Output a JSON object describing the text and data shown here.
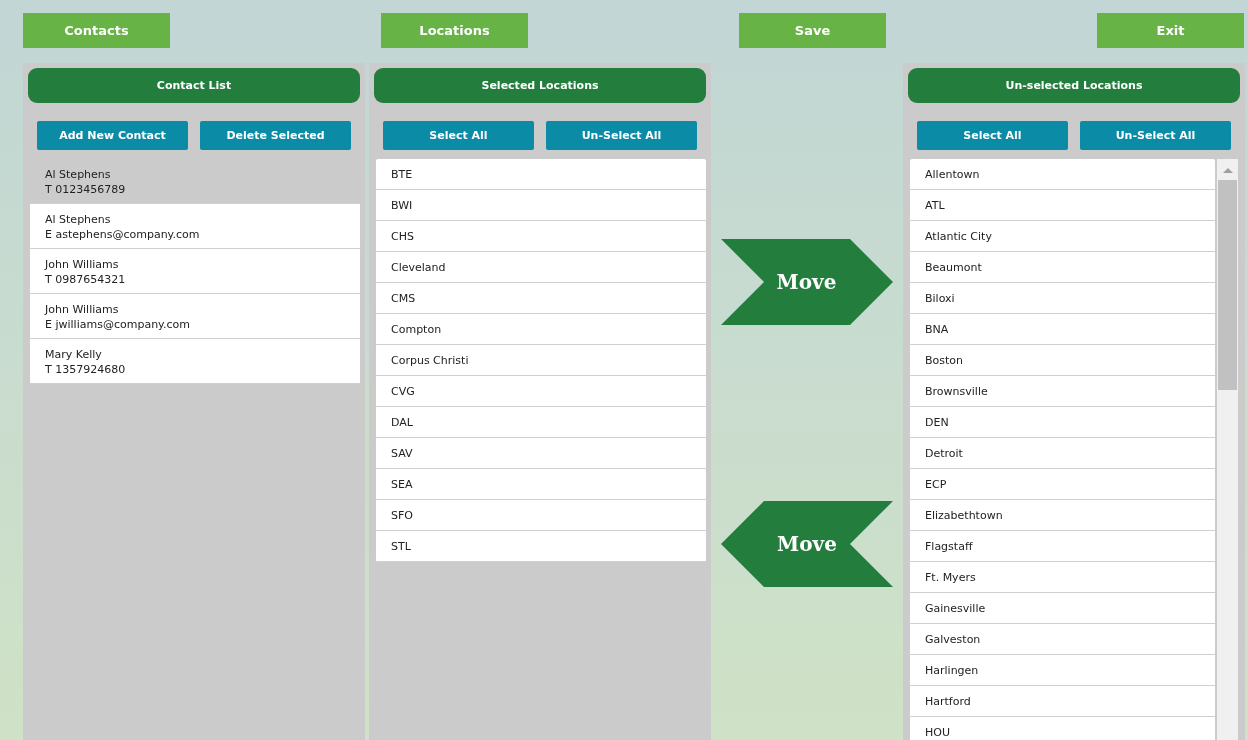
{
  "nav_buttons": [
    "Contacts",
    "Locations",
    "Save",
    "Exit"
  ],
  "contacts_panel": {
    "title": "Contact List",
    "buttons": [
      "Add New Contact",
      "Delete Selected"
    ],
    "items": [
      {
        "name": "Al Stephens",
        "detail": "T 0123456789",
        "selected": true
      },
      {
        "name": "Al Stephens",
        "detail": "E astephens@company.com",
        "selected": false
      },
      {
        "name": "John Williams",
        "detail": "T 0987654321",
        "selected": false
      },
      {
        "name": "John Williams",
        "detail": "E jwilliams@company.com",
        "selected": false
      },
      {
        "name": "Mary Kelly",
        "detail": "T 1357924680",
        "selected": false
      }
    ]
  },
  "selected_panel": {
    "title": "Selected Locations",
    "buttons": [
      "Select All",
      "Un-Select All"
    ],
    "items": [
      "BTE",
      "BWI",
      "CHS",
      "Cleveland",
      "CMS",
      "Compton",
      "Corpus Christi",
      "CVG",
      "DAL",
      "SAV",
      "SEA",
      "SFO",
      "STL"
    ]
  },
  "move_buttons": [
    {
      "label": "Move",
      "kind": "right"
    },
    {
      "label": "Move",
      "kind": "left"
    }
  ],
  "unselected_panel": {
    "title": "Un-selected Locations",
    "buttons": [
      "Select All",
      "Un-Select All"
    ],
    "items": [
      "Allentown",
      "ATL",
      "Atlantic City",
      "Beaumont",
      "Biloxi",
      "BNA",
      "Boston",
      "Brownsville",
      "DEN",
      "Detroit",
      "ECP",
      "Elizabethtown",
      "Flagstaff",
      "Ft. Myers",
      "Gainesville",
      "Galveston",
      "Harlingen",
      "Hartford",
      "HOU"
    ]
  }
}
